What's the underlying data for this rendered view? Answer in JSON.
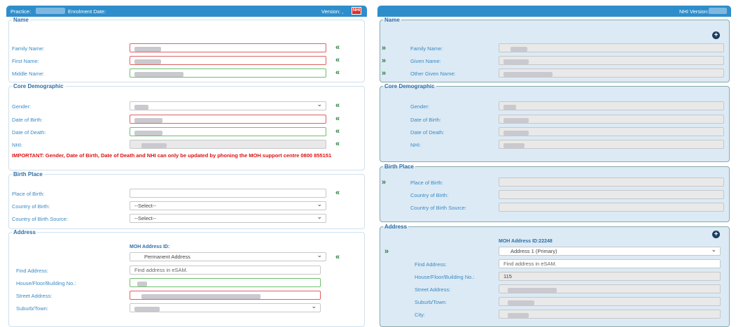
{
  "left": {
    "header": {
      "practice": "Practice:",
      "enrolment": "Enrolment Date:",
      "version": "Version: ,",
      "badge": "NHI"
    },
    "name": {
      "legend": "Name",
      "family": "Family Name:",
      "first": "First Name:",
      "middle": "Middle Name:"
    },
    "core": {
      "legend": "Core Demographic",
      "gender": "Gender:",
      "dob": "Date of Birth:",
      "dod": "Date of Death:",
      "nhi": "NHI:",
      "warning": "IMPORTANT: Gender, Date of Birth, Date of Death and NHI can only be updated by phoning the MOH support centre 0800 855151"
    },
    "birth": {
      "legend": "Birth Place",
      "place": "Place of Birth:",
      "country": "Country of Birth:",
      "source": "Country of Birth Source:",
      "select": "--Select--"
    },
    "address": {
      "legend": "Address",
      "moh": "MOH Address ID:",
      "type": "Permanent Address",
      "find": "Find Address:",
      "find_ph": "Find address in eSAM.",
      "house": "House/Floor/Building No.:",
      "street": "Street Address:",
      "suburb": "Suburb/Town:"
    }
  },
  "right": {
    "header": {
      "nhi_version": "NHI Version:"
    },
    "name": {
      "legend": "Name",
      "family": "Family Name:",
      "given": "Given Name:",
      "other": "Other Given Name:"
    },
    "core": {
      "legend": "Core Demographic",
      "gender": "Gender:",
      "dob": "Date of Birth:",
      "dod": "Date of Death:",
      "nhi": "NHI:"
    },
    "birth": {
      "legend": "Birth Place",
      "place": "Place of Birth:",
      "country": "Country of Birth:",
      "source": "Country of Birth Source:"
    },
    "address": {
      "legend": "Address",
      "moh": "MOH Address ID:22248",
      "type": "Address 1 (Primary)",
      "find": "Find Address:",
      "find_ph": "Find address in eSAM.",
      "house": "House/Floor/Building No.:",
      "house_val": "115",
      "street": "Street Address:",
      "suburb": "Suburb/Town:",
      "city": "City:"
    }
  },
  "icons": {
    "copy_left": "double-chevron-left-icon",
    "copy_right": "double-chevron-right-icon",
    "add": "plus-circle-icon"
  }
}
